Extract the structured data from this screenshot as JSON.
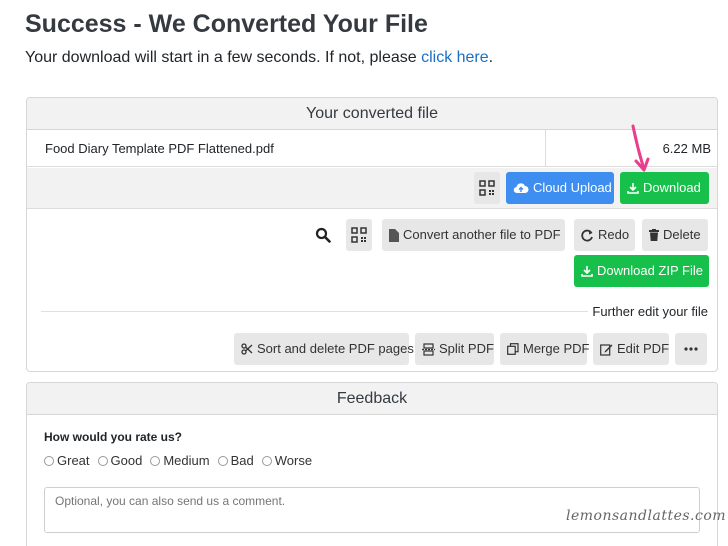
{
  "header": {
    "title": "Success - We Converted Your File",
    "subtitle_prefix": "Your download will start in a few seconds. If not, please ",
    "subtitle_link": "click here",
    "subtitle_suffix": "."
  },
  "converted_card": {
    "title": "Your converted file",
    "file_name": "Food Diary Template PDF Flattened.pdf",
    "file_size": "6.22 MB",
    "cloud_upload_label": "Cloud Upload",
    "download_label": "Download",
    "convert_another_label": "Convert another file to PDF",
    "redo_label": "Redo",
    "delete_label": "Delete",
    "download_zip_label": "Download ZIP File",
    "further_edit_label": "Further edit your file",
    "tools": {
      "sort_delete": "Sort and delete PDF pages",
      "split": "Split PDF",
      "merge": "Merge PDF",
      "edit": "Edit PDF"
    }
  },
  "feedback_card": {
    "title": "Feedback",
    "rate_question": "How would you rate us?",
    "options": [
      "Great",
      "Good",
      "Medium",
      "Bad",
      "Worse"
    ],
    "comment_placeholder": "Optional, you can also send us a comment."
  },
  "watermark": "lemonsandlattes.com",
  "colors": {
    "link": "#1a6fc4",
    "blue_button": "#3d8ef0",
    "green_button": "#17c04a",
    "arrow": "#e83e8c"
  }
}
